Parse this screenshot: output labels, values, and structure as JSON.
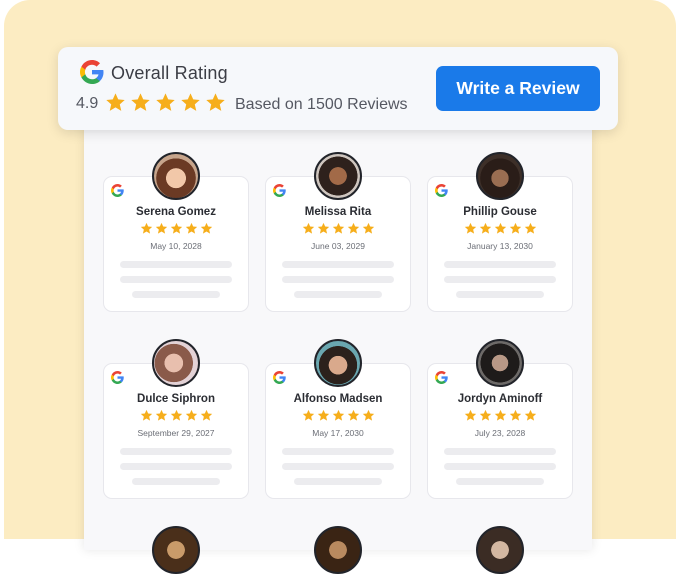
{
  "header": {
    "title": "Overall Rating",
    "score": "4.9",
    "stars": 5,
    "based_on": "Based on 1500 Reviews",
    "write_button": "Write a Review"
  },
  "colors": {
    "background": "#fcecc2",
    "accent": "#1a7ae9",
    "star": "#f6ae1b"
  },
  "reviews": [
    {
      "name": "Serena Gomez",
      "date": "May 10, 2028",
      "stars": 5
    },
    {
      "name": "Melissa Rita",
      "date": "June 03, 2029",
      "stars": 5
    },
    {
      "name": "Phillip Gouse",
      "date": "January 13, 2030",
      "stars": 5
    },
    {
      "name": "Dulce Siphron",
      "date": "September 29, 2027",
      "stars": 5
    },
    {
      "name": "Alfonso Madsen",
      "date": "May 17, 2030",
      "stars": 5
    },
    {
      "name": "Jordyn Aminoff",
      "date": "July 23, 2028",
      "stars": 5
    }
  ]
}
